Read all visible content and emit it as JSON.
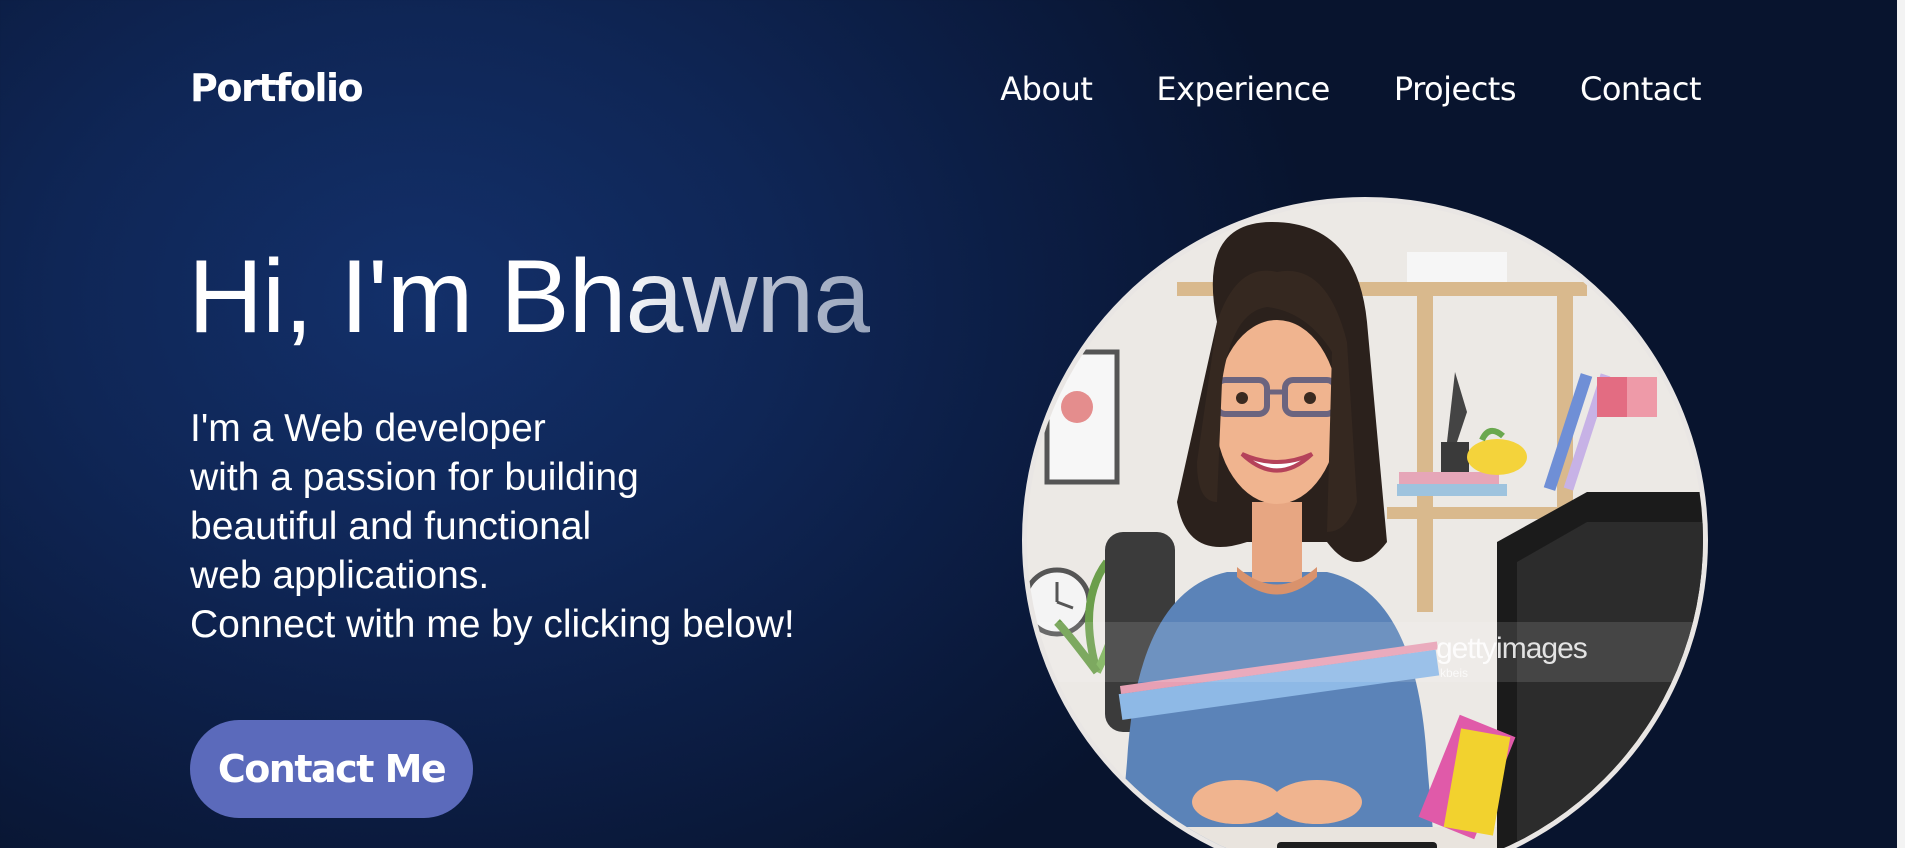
{
  "nav": {
    "logo": "Portfolio",
    "links": [
      "About",
      "Experience",
      "Projects",
      "Contact"
    ]
  },
  "hero": {
    "title": "Hi, I'm Bhawna",
    "description_lines": [
      "I'm a Web developer",
      "with a passion for building",
      "beautiful and functional",
      "web applications.",
      "Connect with me by clicking below!"
    ],
    "cta_label": "Contact Me"
  },
  "avatar": {
    "watermark_brand": "gettyimages",
    "watermark_credit": "kbeis"
  },
  "colors": {
    "background": "#0f2656",
    "accent_button": "#5b6abb",
    "text": "#ffffff"
  }
}
